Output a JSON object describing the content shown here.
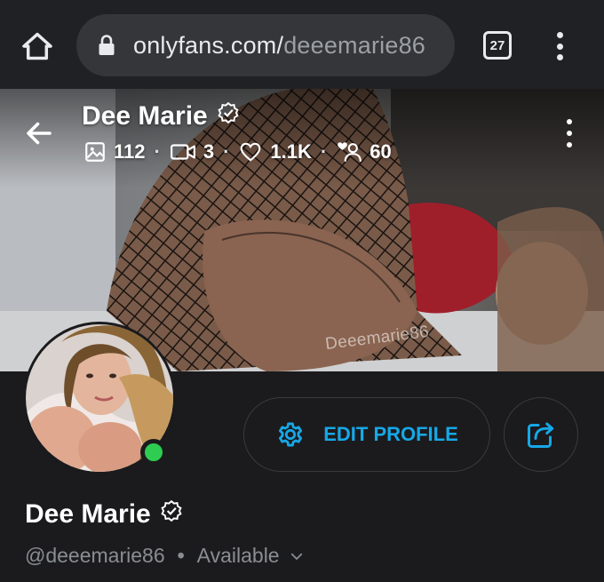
{
  "browser": {
    "url_host": "onlyfans.com/",
    "url_path": "deeemarie86",
    "tab_count": "27"
  },
  "header": {
    "name": "Dee Marie",
    "stats": {
      "photos": "112",
      "videos": "3",
      "likes": "1.1K",
      "fans": "60"
    },
    "watermark": "Deeemarie86"
  },
  "actions": {
    "edit_label": "EDIT PROFILE"
  },
  "profile": {
    "name": "Dee Marie",
    "handle": "@deeemarie86",
    "separator": "•",
    "status": "Available"
  },
  "colors": {
    "accent": "#16a8e8",
    "online": "#2ecc51",
    "background": "#1b1b1d"
  },
  "icons": [
    "home-icon",
    "lock-icon",
    "tabs-icon",
    "more-vert-icon",
    "back-arrow-icon",
    "verified-icon",
    "image-icon",
    "video-icon",
    "heart-icon",
    "fans-icon",
    "gear-icon",
    "share-icon",
    "chevron-down-icon"
  ]
}
